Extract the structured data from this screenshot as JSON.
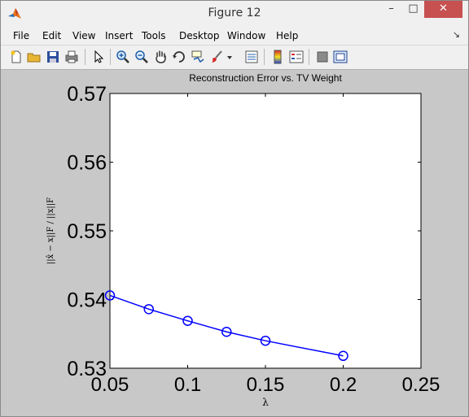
{
  "window": {
    "title": "Figure 12",
    "minimize_glyph": "–",
    "maximize_glyph": "□",
    "close_glyph": "✕"
  },
  "menu": {
    "items": [
      "File",
      "Edit",
      "View",
      "Insert",
      "Tools",
      "Desktop",
      "Window",
      "Help"
    ],
    "overflow_glyph": "↘"
  },
  "toolbar": {
    "icons": [
      "new-figure-icon",
      "open-file-icon",
      "save-icon",
      "print-icon",
      "edit-plot-arrow-icon",
      "zoom-in-icon",
      "zoom-out-icon",
      "pan-hand-icon",
      "rotate-3d-icon",
      "data-cursor-icon",
      "brush-icon",
      "brush-dropdown-icon",
      "link-plot-icon",
      "colorbar-icon",
      "legend-icon",
      "hide-plot-tools-icon",
      "show-plot-tools-icon"
    ]
  },
  "chart_data": {
    "type": "line",
    "title": "Reconstruction Error vs. TV Weight",
    "xlabel": "λ",
    "ylabel": "||x̂ − x||F / ||x||F",
    "xlim": [
      0.05,
      0.25
    ],
    "ylim": [
      0.53,
      0.57
    ],
    "x_ticks": [
      "0.05",
      "0.1",
      "0.15",
      "0.2",
      "0.25"
    ],
    "y_ticks": [
      "0.53",
      "0.54",
      "0.55",
      "0.56",
      "0.57"
    ],
    "grid": false,
    "series": [
      {
        "color": "#0000ff",
        "marker": "circle",
        "x": [
          0.05,
          0.075,
          0.1,
          0.125,
          0.15,
          0.2
        ],
        "y": [
          0.5406,
          0.5386,
          0.5369,
          0.5353,
          0.534,
          0.5318
        ]
      }
    ]
  }
}
